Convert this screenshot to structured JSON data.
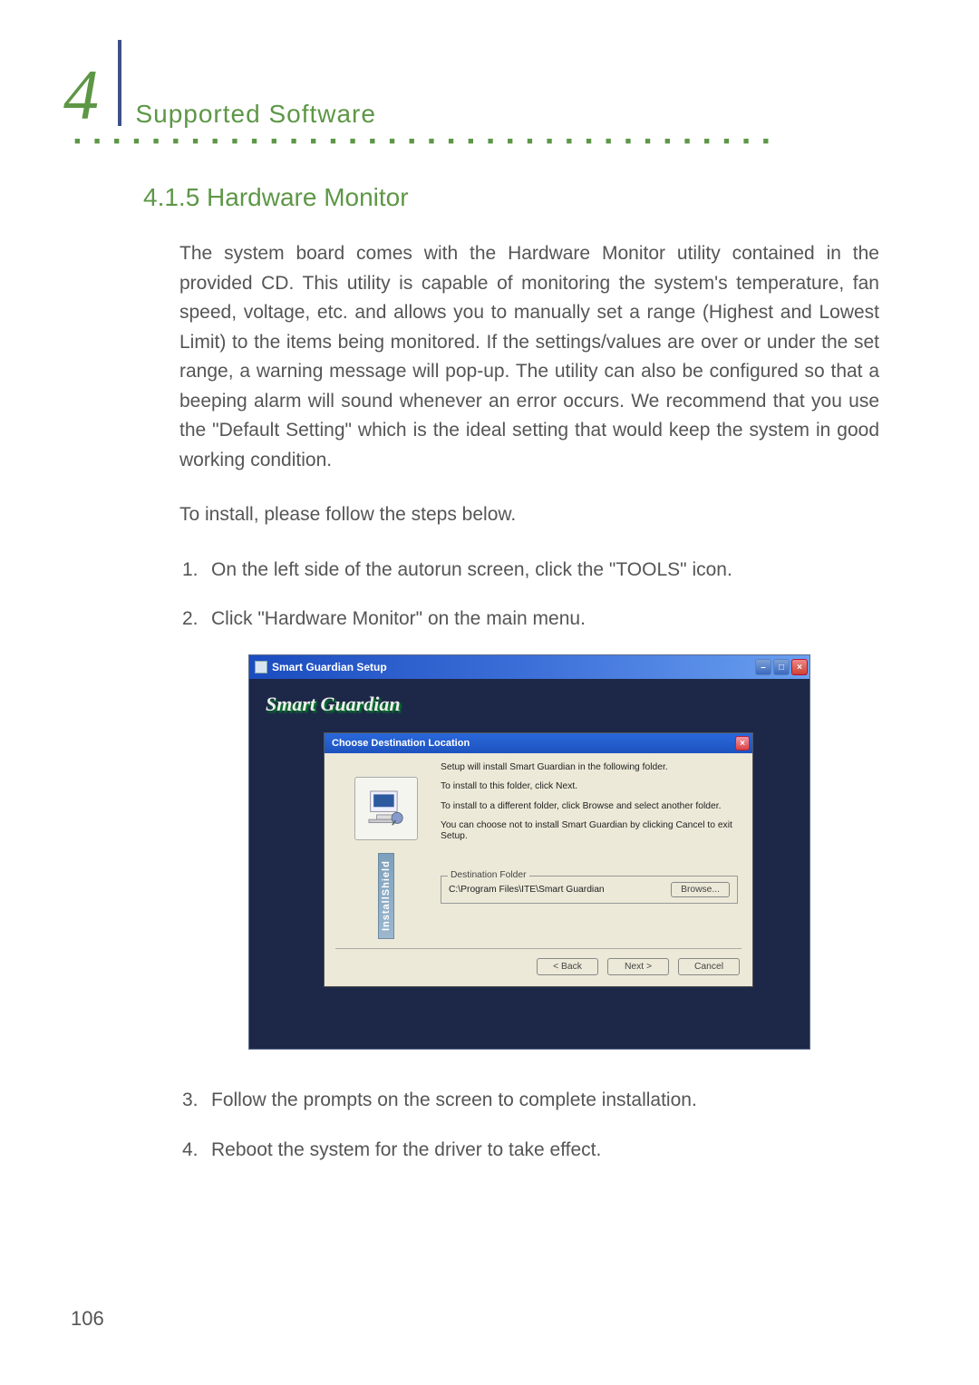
{
  "chapter": {
    "number": "4",
    "title": "Supported Software",
    "dots": "■ ■ ■ ■ ■ ■ ■ ■ ■ ■ ■ ■ ■ ■ ■ ■ ■ ■ ■ ■ ■ ■ ■ ■ ■ ■ ■ ■ ■ ■ ■ ■ ■ ■ ■ ■"
  },
  "section": {
    "number_title": "4.1.5  Hardware Monitor"
  },
  "body": {
    "intro": "The system board comes with the Hardware Monitor utility contained in the provided CD. This utility is capable of monitoring the system's temperature, fan speed, voltage, etc. and allows you to manually set a range (Highest and Lowest Limit) to the items being monitored. If the settings/values are over or under the set range, a warning message will pop-up. The utility can also be configured so that a beeping alarm will sound whenever an error occurs. We recommend that you use the \"Default Setting\" which is the ideal setting that would keep the system in good working condition.",
    "install_lead": "To install, please follow the steps below.",
    "steps": [
      {
        "num": "1.",
        "text": "On the left side of the autorun screen, click the \"TOOLS\" icon."
      },
      {
        "num": "2.",
        "text": "Click \"Hardware Monitor\" on the main menu."
      },
      {
        "num": "3.",
        "text": "Follow the prompts on the screen to complete installation."
      },
      {
        "num": "4.",
        "text": "Reboot the system for the driver to take effect."
      }
    ]
  },
  "installer": {
    "window_title": "Smart Guardian Setup",
    "banner": "Smart Guardian",
    "dialog_title": "Choose Destination Location",
    "sidebar_label": "InstallShield",
    "lines": {
      "l1": "Setup will install Smart Guardian in the following folder.",
      "l2": "To install to this folder, click Next.",
      "l3": "To install to a different folder, click Browse and select another folder.",
      "l4": "You can choose not to install Smart Guardian by clicking Cancel to exit Setup."
    },
    "dest_legend": "Destination Folder",
    "dest_path": "C:\\Program Files\\ITE\\Smart Guardian",
    "buttons": {
      "browse": "Browse...",
      "back": "< Back",
      "next": "Next >",
      "cancel": "Cancel"
    },
    "winctrls": {
      "min": "–",
      "max": "□",
      "close": "×"
    }
  },
  "page_number": "106"
}
